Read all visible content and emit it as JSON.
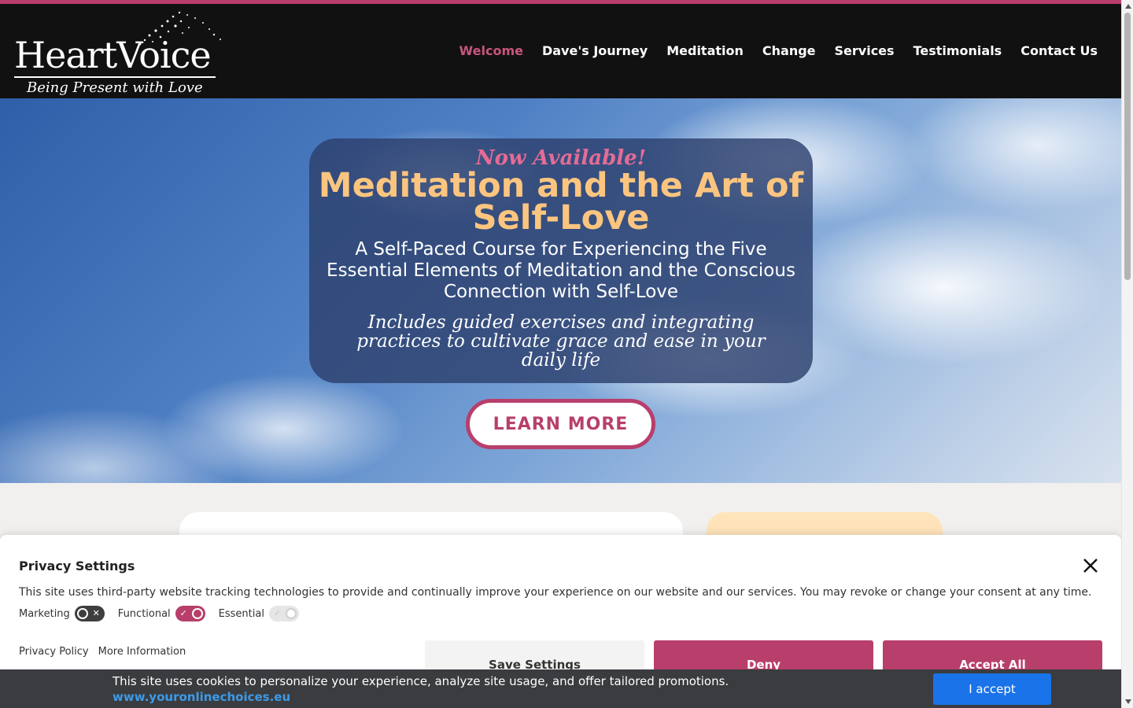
{
  "colors": {
    "accent": "#b83f6b",
    "header_bg": "#121111",
    "hero_title": "#fcc57f",
    "now_available": "#e56c95",
    "cookie_button": "#1a73e8",
    "cookie_link": "#3d9ae8"
  },
  "logo": {
    "name": "HeartVoice",
    "tagline": "Being Present with Love"
  },
  "nav": {
    "items": [
      {
        "label": "Welcome",
        "active": true
      },
      {
        "label": "Dave's Journey",
        "active": false
      },
      {
        "label": "Meditation",
        "active": false
      },
      {
        "label": "Change",
        "active": false
      },
      {
        "label": "Services",
        "active": false
      },
      {
        "label": "Testimonials",
        "active": false
      },
      {
        "label": "Contact Us",
        "active": false
      }
    ]
  },
  "hero": {
    "now_available": "Now Available!",
    "title": "Meditation and the Art of Self-Love",
    "subtitle": "A Self-Paced Course for Experiencing the Five Essential Elements of Meditation and the Conscious Connection with Self-Love",
    "italic": "Includes guided exercises and integrating practices to cultivate grace and ease in your daily life",
    "button": "LEARN MORE"
  },
  "privacy": {
    "title": "Privacy Settings",
    "text": "This site uses third-party website tracking technologies to provide and continually improve your experience on our website and our services. You may revoke or change your consent at any time.",
    "toggles": [
      {
        "label": "Marketing",
        "state": "off"
      },
      {
        "label": "Functional",
        "state": "on"
      },
      {
        "label": "Essential",
        "state": "on-disabled"
      }
    ],
    "links": [
      "Privacy Policy",
      "More Information"
    ],
    "buttons": {
      "save": "Save Settings",
      "deny": "Deny",
      "accept": "Accept All"
    },
    "close_icon": "close-icon"
  },
  "cookie_bar": {
    "text": "This site uses cookies to personalize your experience, analyze site usage, and offer tailored promotions.",
    "link": "www.youronlinechoices.eu",
    "button": "I accept"
  }
}
